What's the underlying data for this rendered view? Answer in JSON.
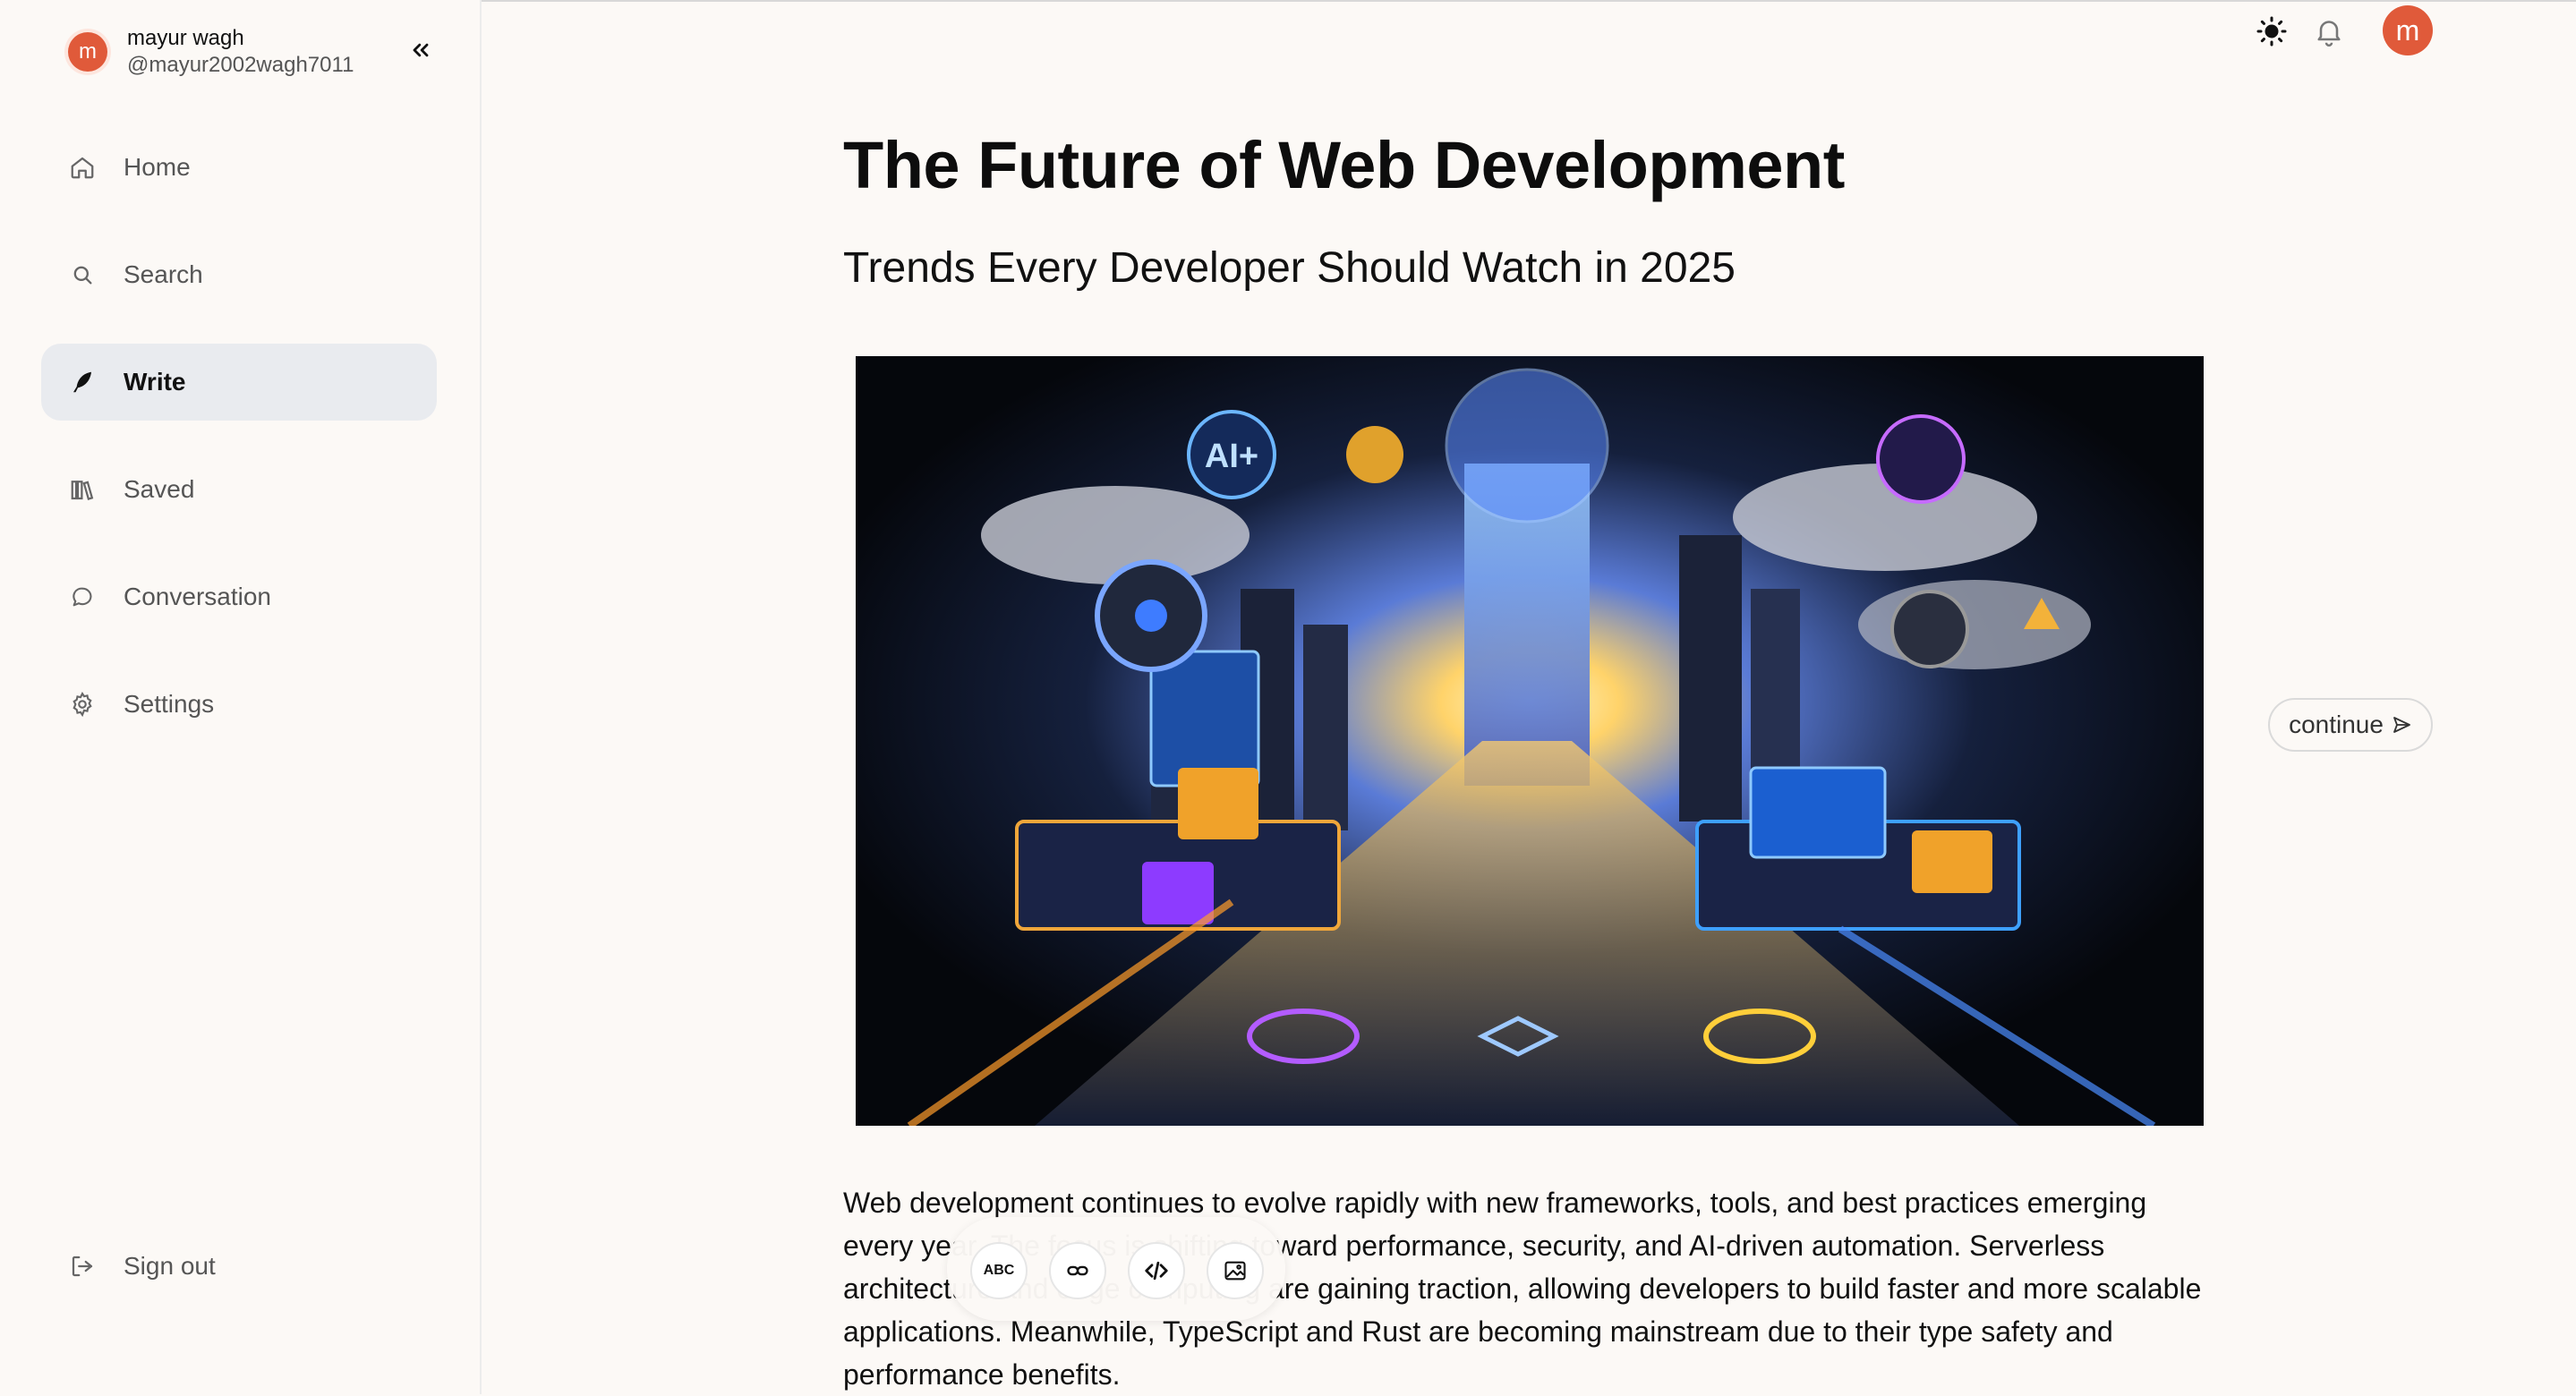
{
  "user": {
    "initial": "m",
    "name": "mayur wagh",
    "handle": "@mayur2002wagh7011"
  },
  "sidebar": {
    "items": [
      {
        "label": "Home",
        "icon": "home-icon"
      },
      {
        "label": "Search",
        "icon": "search-icon"
      },
      {
        "label": "Write",
        "icon": "feather-icon",
        "active": true
      },
      {
        "label": "Saved",
        "icon": "library-icon"
      },
      {
        "label": "Conversation",
        "icon": "chat-bubble-icon"
      },
      {
        "label": "Settings",
        "icon": "gear-icon"
      }
    ],
    "signout": {
      "label": "Sign out",
      "icon": "sign-out-icon"
    }
  },
  "header": {
    "icons": [
      "sun-icon",
      "bell-icon"
    ],
    "avatar_initial": "m"
  },
  "article": {
    "title": "The Future of Web Development",
    "subtitle": "Trends Every Developer Should Watch in 2025",
    "body": "Web development continues to evolve rapidly with new frameworks, tools, and best practices emerging every year. The focus is shifting toward performance, security, and AI-driven automation. Serverless architecture and edge computing are gaining traction, allowing developers to build faster and more scalable applications. Meanwhile, TypeScript and Rust are becoming mainstream due to their type safety and performance benefits."
  },
  "continue_button": {
    "label": "continue"
  },
  "toolbar": {
    "spellcheck_label": "ABC",
    "tools": [
      "spellcheck-icon",
      "link-icon",
      "code-icon",
      "image-icon"
    ]
  },
  "colors": {
    "accent": "#e05a3a",
    "background": "#fcf9f6",
    "active_nav": "#e9ebef"
  }
}
